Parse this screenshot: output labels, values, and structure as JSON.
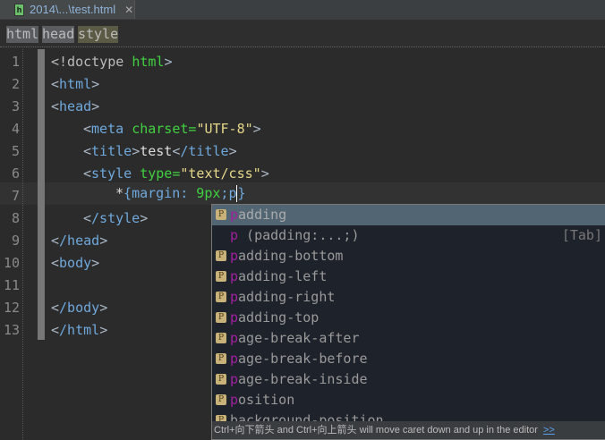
{
  "tab": {
    "title": "2014\\...\\test.html",
    "icon": "html-file-icon"
  },
  "breadcrumbs": [
    "html",
    "head",
    "style"
  ],
  "line_numbers": [
    "1",
    "2",
    "3",
    "4",
    "5",
    "6",
    "7",
    "8",
    "9",
    "10",
    "11",
    "12",
    "13"
  ],
  "code": {
    "l1a": "<!doctype ",
    "l1b": "html",
    "l1c": ">",
    "l2": "html",
    "l3": "head",
    "l4a": "meta",
    "l4b": "charset=",
    "l4c": "\"UTF-8\"",
    "l5a": "title",
    "l5b": "test",
    "l5c": "/title",
    "l6a": "style",
    "l6b": "type=",
    "l6c": "\"text/css\"",
    "l7a": "*",
    "l7b": "{",
    "l7c": "margin:",
    "l7d": " 9px",
    "l7e": ";",
    "l7f": "p",
    "l7g": "}",
    "l8": "/style",
    "l9": "/head",
    "l10": "body",
    "l12": "/body",
    "l13": "/html"
  },
  "autocomplete": {
    "items": [
      {
        "m": "p",
        "rest": "adding"
      },
      {
        "m": "p",
        "rest": "adding-bottom"
      },
      {
        "m": "p",
        "rest": "adding-left"
      },
      {
        "m": "p",
        "rest": "adding-right"
      },
      {
        "m": "p",
        "rest": "adding-top"
      },
      {
        "m": "p",
        "rest": "age-break-after"
      },
      {
        "m": "p",
        "rest": "age-break-before"
      },
      {
        "m": "p",
        "rest": "age-break-inside"
      },
      {
        "m": "p",
        "rest": "osition"
      },
      {
        "m": "",
        "rest": "background-position"
      }
    ],
    "template": {
      "m": "p",
      "rest": " (padding:...;)",
      "hint": "[Tab]"
    },
    "footer": "Ctrl+向下箭头 and Ctrl+向上箭头 will move caret down and up in the editor",
    "footer_link": ">>"
  }
}
